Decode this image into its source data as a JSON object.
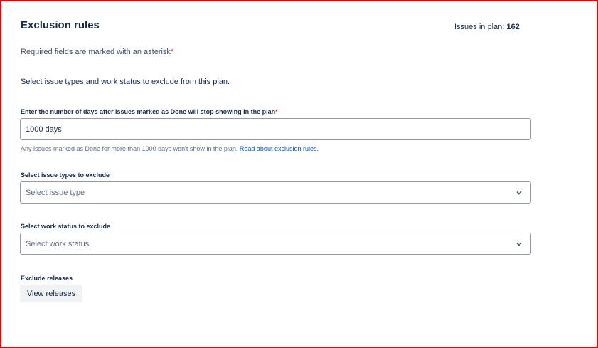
{
  "header": {
    "title": "Exclusion rules",
    "issues_label": "Issues in plan:",
    "issues_count": "162"
  },
  "required_note": {
    "text": "Required fields are marked with an asterisk",
    "asterisk": "*"
  },
  "intro": "Select issue types and work status to exclude from this plan.",
  "days_field": {
    "label": "Enter the number of days after issues marked as Done will stop showing in the plan",
    "asterisk": "*",
    "value": "1000 days",
    "help_text": "Any issues marked as Done for more than 1000 days won't show in the plan.",
    "help_link": "Read about exclusion rules."
  },
  "issue_types": {
    "label": "Select issue types to exclude",
    "placeholder": "Select issue type",
    "icon": "chevron-down-icon"
  },
  "work_status": {
    "label": "Select work status to exclude",
    "placeholder": "Select work status",
    "icon": "chevron-down-icon"
  },
  "releases": {
    "label": "Exclude releases",
    "button_label": "View releases"
  },
  "colors": {
    "frame_border": "#e8000b",
    "text": "#172b4d",
    "link": "#0052cc",
    "required": "#de350b",
    "button_bg": "#f1f2f4"
  }
}
